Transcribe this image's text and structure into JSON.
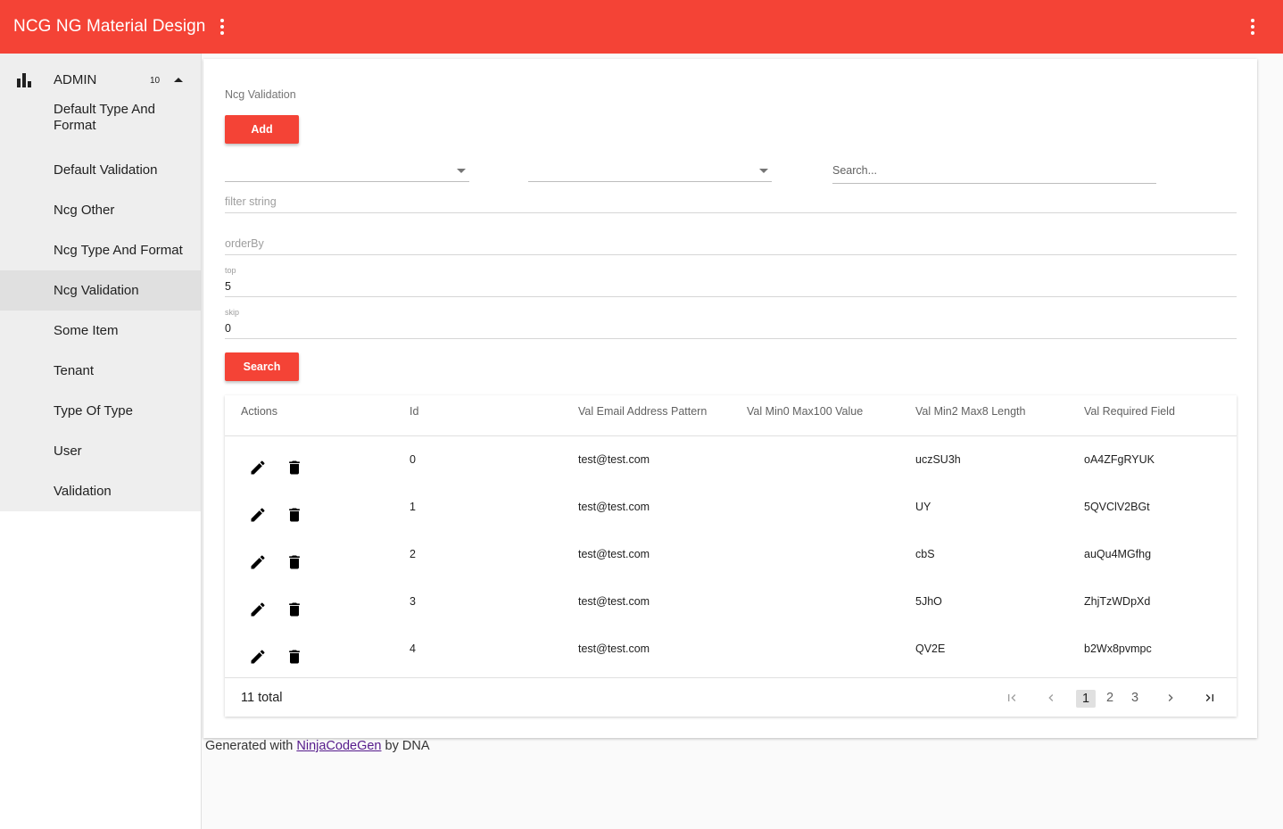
{
  "app": {
    "title": "NCG NG Material Design"
  },
  "sidebar": {
    "group": {
      "label": "ADMIN",
      "count": "10"
    },
    "items": [
      {
        "label": "Default Type And Format"
      },
      {
        "label": "Default Validation"
      },
      {
        "label": "Ncg Other"
      },
      {
        "label": "Ncg Type And Format"
      },
      {
        "label": "Ncg Validation",
        "active": true
      },
      {
        "label": "Some Item"
      },
      {
        "label": "Tenant"
      },
      {
        "label": "Type Of Type"
      },
      {
        "label": "User"
      },
      {
        "label": "Validation"
      }
    ]
  },
  "main": {
    "title": "Ncg Validation",
    "add_label": "Add",
    "search_placeholder": "Search...",
    "filter_placeholder": "filter string",
    "orderby_placeholder": "orderBy",
    "top": {
      "label": "top",
      "value": "5"
    },
    "skip": {
      "label": "skip",
      "value": "0"
    },
    "search_label": "Search"
  },
  "table": {
    "columns": [
      "Actions",
      "Id",
      "Val Email Address Pattern",
      "Val Min0 Max100 Value",
      "Val Min2 Max8 Length",
      "Val Required Field"
    ],
    "rows": [
      {
        "id": "0",
        "email": "test@test.com",
        "minmax": "",
        "length": "uczSU3h",
        "required": "oA4ZFgRYUK"
      },
      {
        "id": "1",
        "email": "test@test.com",
        "minmax": "",
        "length": "UY",
        "required": "5QVClV2BGt"
      },
      {
        "id": "2",
        "email": "test@test.com",
        "minmax": "",
        "length": "cbS",
        "required": "auQu4MGfhg"
      },
      {
        "id": "3",
        "email": "test@test.com",
        "minmax": "",
        "length": "5JhO",
        "required": "ZhjTzWDpXd"
      },
      {
        "id": "4",
        "email": "test@test.com",
        "minmax": "",
        "length": "QV2E",
        "required": "b2Wx8pvmpc"
      }
    ],
    "total": "11 total",
    "pages": [
      "1",
      "2",
      "3"
    ],
    "current_page": "1"
  },
  "footer": {
    "prefix": "Generated with",
    "link": "NinjaCodeGen",
    "suffix": "by DNA"
  },
  "colors": {
    "primary": "#f44336",
    "sidebar_group_bg": "#eeeeee",
    "active_item_bg": "#e0e0e0"
  }
}
